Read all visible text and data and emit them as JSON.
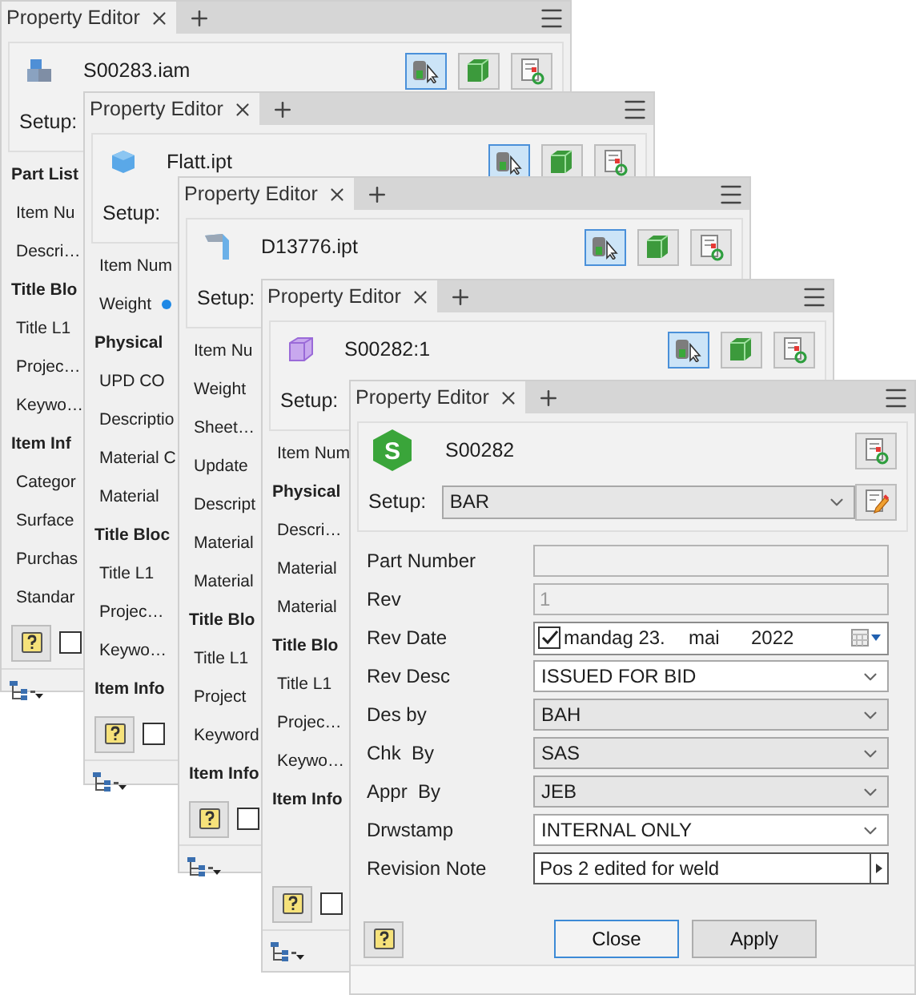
{
  "windows": [
    {
      "tab": "Property Editor",
      "file": "S00283.iam",
      "setup_label": "Setup:",
      "tools": [
        {
          "kind": "select",
          "selected": true
        },
        {
          "kind": "component",
          "selected": false
        },
        {
          "kind": "refresh",
          "selected": false
        }
      ],
      "rows": [
        {
          "kind": "section",
          "text": "Part List"
        },
        {
          "kind": "property",
          "text": "Item Nu"
        },
        {
          "kind": "property",
          "text": "Descri…"
        },
        {
          "kind": "section",
          "text": "Title Blo"
        },
        {
          "kind": "property",
          "text": "Title L1"
        },
        {
          "kind": "property",
          "text": "Projec…"
        },
        {
          "kind": "property",
          "text": "Keywo…"
        },
        {
          "kind": "section",
          "text": "Item Inf"
        },
        {
          "kind": "property",
          "text": "Categor"
        },
        {
          "kind": "property",
          "text": "Surface"
        },
        {
          "kind": "property",
          "text": "Purchas"
        },
        {
          "kind": "property",
          "text": "Standar"
        }
      ],
      "checked": false
    },
    {
      "tab": "Property Editor",
      "file": "Flatt.ipt",
      "setup_label": "Setup:",
      "tools": [
        {
          "kind": "select",
          "selected": true
        },
        {
          "kind": "component",
          "selected": false
        },
        {
          "kind": "refresh",
          "selected": false
        }
      ],
      "rows": [
        {
          "kind": "property",
          "text": "Item Num"
        },
        {
          "kind": "flagged",
          "text": "Weight"
        },
        {
          "kind": "section",
          "text": "Physical"
        },
        {
          "kind": "property",
          "text": "UPD CO"
        },
        {
          "kind": "property",
          "text": "Descriptio"
        },
        {
          "kind": "property",
          "text": "Material C"
        },
        {
          "kind": "property",
          "text": "Material"
        },
        {
          "kind": "section",
          "text": "Title Bloc"
        },
        {
          "kind": "property",
          "text": "Title L1"
        },
        {
          "kind": "property",
          "text": "Projec…"
        },
        {
          "kind": "property",
          "text": "Keywo…"
        },
        {
          "kind": "section",
          "text": "Item Info"
        }
      ],
      "checked": false
    },
    {
      "tab": "Property Editor",
      "file": "D13776.ipt",
      "setup_label": "Setup:",
      "tools": [
        {
          "kind": "select",
          "selected": true
        },
        {
          "kind": "component",
          "selected": false
        },
        {
          "kind": "refresh",
          "selected": false
        }
      ],
      "rows": [
        {
          "kind": "property",
          "text": "Item Nu"
        },
        {
          "kind": "property",
          "text": "Weight"
        },
        {
          "kind": "property",
          "text": "Sheet…"
        },
        {
          "kind": "property",
          "text": "Update"
        },
        {
          "kind": "property",
          "text": "Descript"
        },
        {
          "kind": "property",
          "text": "Material"
        },
        {
          "kind": "property",
          "text": "Material"
        },
        {
          "kind": "section",
          "text": "Title Blo"
        },
        {
          "kind": "property",
          "text": "Title L1"
        },
        {
          "kind": "property",
          "text": "Project"
        },
        {
          "kind": "property",
          "text": "Keyword"
        },
        {
          "kind": "section",
          "text": "Item Info"
        }
      ],
      "checked": false
    },
    {
      "tab": "Property Editor",
      "file": "S00282:1",
      "setup_label": "Setup:",
      "tools": [
        {
          "kind": "select",
          "selected": true
        },
        {
          "kind": "component",
          "selected": false
        },
        {
          "kind": "refresh",
          "selected": false
        }
      ],
      "rows": [
        {
          "kind": "property",
          "text": "Item Num"
        },
        {
          "kind": "section",
          "text": "Physical"
        },
        {
          "kind": "property",
          "text": "Descri…"
        },
        {
          "kind": "property",
          "text": "Material"
        },
        {
          "kind": "property",
          "text": "Material"
        },
        {
          "kind": "section",
          "text": "Title Blo"
        },
        {
          "kind": "property",
          "text": "Title L1"
        },
        {
          "kind": "property",
          "text": "Projec…"
        },
        {
          "kind": "property",
          "text": "Keywo…"
        },
        {
          "kind": "section",
          "text": "Item Info"
        }
      ],
      "checked": false
    }
  ],
  "front_window": {
    "tab": "Property Editor",
    "logo_letter": "S",
    "file": "S00282",
    "setup_label": "Setup:",
    "setup_value": "BAR",
    "fields": [
      {
        "kind": "text",
        "label": "Part Number",
        "disabled": true
      },
      {
        "kind": "text",
        "label": "Rev",
        "value": "1",
        "disabled": true
      },
      {
        "kind": "date",
        "label": "Rev Date",
        "checked": true,
        "day": "mandag 23.",
        "month": "mai",
        "year": "2022"
      },
      {
        "kind": "combo",
        "label": "Rev Desc",
        "value": "ISSUED FOR BID",
        "editable": true
      },
      {
        "kind": "combo",
        "label": "Des by",
        "value": "BAH",
        "editable": false
      },
      {
        "kind": "combo",
        "label": "Chk  By",
        "value": "SAS",
        "editable": false
      },
      {
        "kind": "combo",
        "label": "Appr  By",
        "value": "JEB",
        "editable": false
      },
      {
        "kind": "combo",
        "label": "Drwstamp",
        "value": "INTERNAL ONLY",
        "editable": true
      },
      {
        "kind": "note",
        "label": "Revision Note",
        "value": "Pos 2 edited for weld"
      }
    ],
    "buttons": [
      {
        "label": "Close",
        "focused": true
      },
      {
        "label": "Apply",
        "focused": false
      }
    ]
  }
}
